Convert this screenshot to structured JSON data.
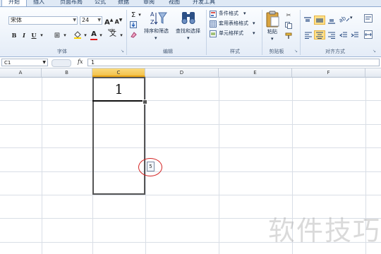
{
  "tabs": [
    "开始",
    "插入",
    "页面布局",
    "公式",
    "数据",
    "审阅",
    "视图",
    "开发工具"
  ],
  "active_tab": "开始",
  "ribbon": {
    "font": {
      "group_label": "字体",
      "font_name": "宋体",
      "font_size": "24",
      "bold": "B",
      "italic": "I",
      "underline": "U",
      "grow_font": "A",
      "shrink_font": "A",
      "font_color_letter": "A",
      "wen_label": "wén"
    },
    "editing": {
      "group_label": "编辑",
      "sort_filter": "排序和筛选",
      "find_select": "查找和选择"
    },
    "styles": {
      "group_label": "样式",
      "conditional_format": "条件格式",
      "table_format": "套用表格格式",
      "cell_styles": "单元格样式"
    },
    "clipboard": {
      "group_label": "剪贴板",
      "paste": "粘贴"
    },
    "alignment": {
      "group_label": "对齐方式"
    }
  },
  "formula_bar": {
    "name_box": "C1",
    "fx": "fx",
    "value": "1"
  },
  "columns": [
    "A",
    "B",
    "C",
    "D",
    "E",
    "F"
  ],
  "active_column": "C",
  "cells": {
    "C1": "1"
  },
  "autofill_icon_text": "5",
  "watermark": "软件技巧",
  "colors": {
    "selection_border": "#555555",
    "annotation_circle": "#d32222",
    "active_column_header": "#f3c34d"
  }
}
